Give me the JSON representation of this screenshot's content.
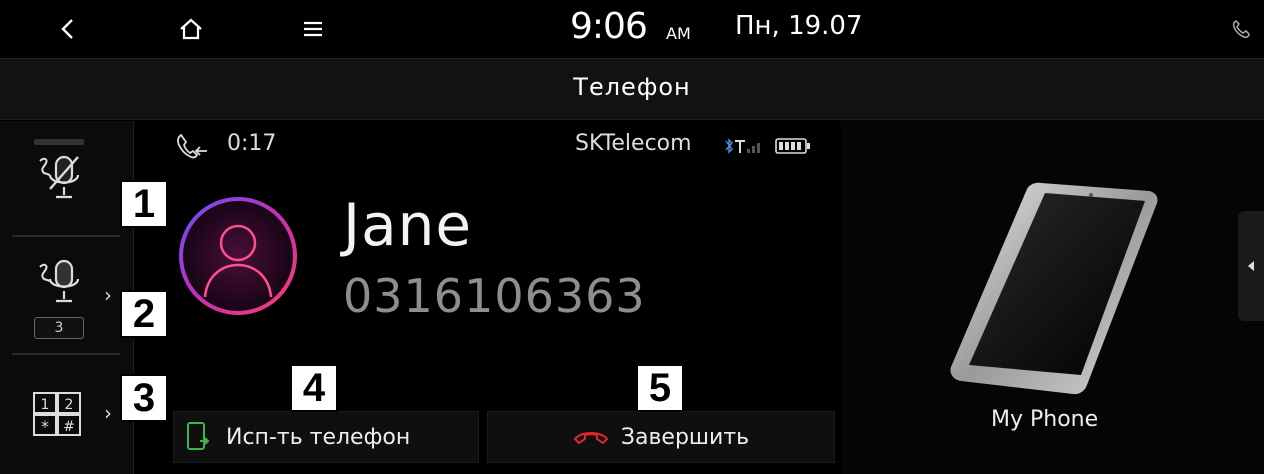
{
  "status_bar": {
    "time": "9:06",
    "ampm": "AM",
    "date": "Пн, 19.07"
  },
  "header": {
    "title": "Телефон"
  },
  "left_rail": {
    "conference_count": "3"
  },
  "call": {
    "duration": "0:17",
    "carrier": "SKTelecom",
    "contact_name": "Jane",
    "contact_number": "0316106363"
  },
  "actions": {
    "use_phone_label": "Исп-ть телефон",
    "end_call_label": "Завершить"
  },
  "right_panel": {
    "device_name": "My Phone"
  },
  "callouts": [
    "1",
    "2",
    "3",
    "4",
    "5"
  ],
  "colors": {
    "end_call_red": "#e0252f",
    "use_phone_green": "#3cb54a",
    "avatar_ring": "#c42fb4"
  }
}
